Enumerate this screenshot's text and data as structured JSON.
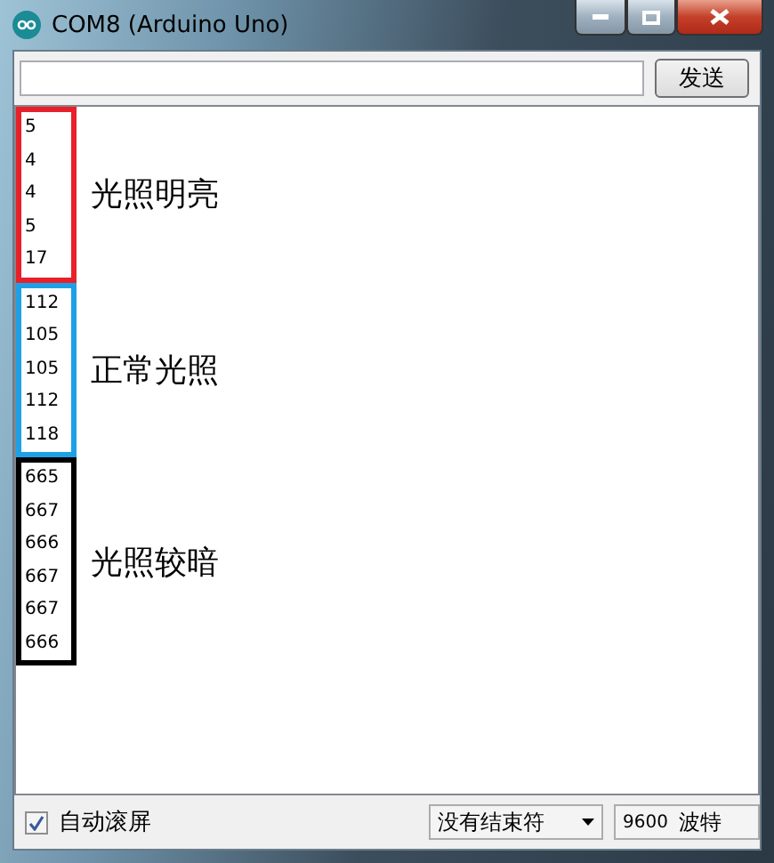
{
  "window": {
    "title": "COM8 (Arduino Uno)"
  },
  "send": {
    "button": "发送"
  },
  "groups": [
    {
      "color": "#e8202a",
      "label": "光照明亮",
      "values": [
        "5",
        "4",
        "4",
        "5",
        "17"
      ]
    },
    {
      "color": "#1ea0e6",
      "label": "正常光照",
      "values": [
        "112",
        "105",
        "105",
        "112",
        "118"
      ]
    },
    {
      "color": "#000000",
      "label": "光照较暗",
      "values": [
        "665",
        "667",
        "666",
        "667",
        "667",
        "666"
      ]
    }
  ],
  "autoscroll": {
    "label": "自动滚屏",
    "checked": true
  },
  "line_ending": {
    "value": "没有结束符"
  },
  "baud": {
    "rate": "9600",
    "unit": "波特"
  }
}
